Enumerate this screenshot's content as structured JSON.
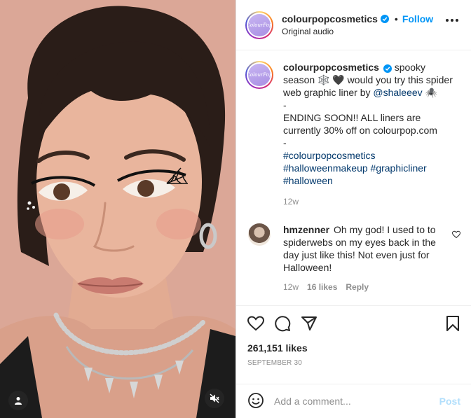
{
  "post": {
    "username": "colourpopcosmetics",
    "follow_label": "Follow",
    "separator": "•",
    "audio": "Original audio",
    "avatar_text": "ColourPop"
  },
  "caption": {
    "username": "colourpopcosmetics",
    "line1": "spooky season 🕸️ 🖤 would you try this spider web graphic liner by ",
    "mention": "@shaleeev",
    "line1_end": " 🕷️",
    "dash1": "-",
    "line2": "ENDING SOON!! ALL liners are currently 30% off on colourpop.com",
    "dash2": "-",
    "hashtags": [
      "#colourpopcosmetics",
      "#halloweenmakeup",
      "#graphicliner",
      "#halloween"
    ],
    "time": "12w"
  },
  "comment": {
    "username": "hmzenner",
    "text": "Oh my god! I used to to spiderwebs on my eyes back in the day just like this! Not even just for Halloween!",
    "time": "12w",
    "likes": "16 likes",
    "reply_label": "Reply"
  },
  "stats": {
    "likes": "261,151 likes",
    "date": "SEPTEMBER 30"
  },
  "composer": {
    "placeholder": "Add a comment...",
    "post_label": "Post"
  },
  "icons": {
    "verified": "verified-badge-icon",
    "more": "more-options-icon",
    "heart": "heart-icon",
    "comment": "comment-icon",
    "share": "share-icon",
    "save": "bookmark-icon",
    "emoji": "emoji-icon",
    "user_tag": "user-icon",
    "mute": "speaker-muted-icon"
  },
  "colors": {
    "accent": "#0095f6",
    "post_disabled": "#b2dffc",
    "muted_text": "#8e8e8e"
  }
}
